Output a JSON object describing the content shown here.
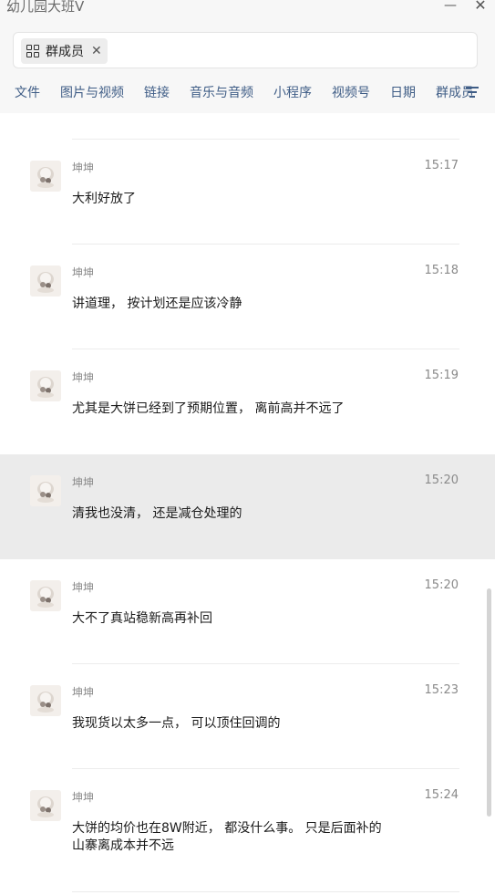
{
  "window": {
    "title": "幼儿园大班V",
    "minimize": "—",
    "close": "✕"
  },
  "search": {
    "chip_label": "群成员",
    "chip_close": "✕"
  },
  "tabs": [
    "文件",
    "图片与视频",
    "链接",
    "音乐与音频",
    "小程序",
    "视频号",
    "日期",
    "群成员"
  ],
  "messages": [
    {
      "name": "坤坤",
      "time": "15:17",
      "text": "大利好放了"
    },
    {
      "name": "坤坤",
      "time": "15:18",
      "text": "讲道理， 按计划还是应该冷静"
    },
    {
      "name": "坤坤",
      "time": "15:19",
      "text": "尤其是大饼已经到了预期位置， 离前高并不远了"
    },
    {
      "name": "坤坤",
      "time": "15:20",
      "text": "清我也没清， 还是减仓处理的"
    },
    {
      "name": "坤坤",
      "time": "15:20",
      "text": "大不了真站稳新高再补回"
    },
    {
      "name": "坤坤",
      "time": "15:23",
      "text": "我现货以太多一点， 可以顶住回调的"
    },
    {
      "name": "坤坤",
      "time": "15:24",
      "text": "大饼的均价也在8W附近， 都没什么事。 只是后面补的\n山寨离成本并不远"
    }
  ]
}
